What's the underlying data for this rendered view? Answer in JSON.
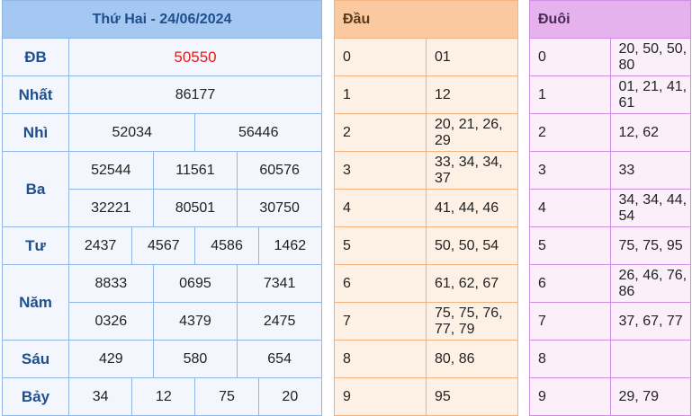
{
  "results": {
    "title": "Thứ Hai - 24/06/2024",
    "db": {
      "label": "ĐB",
      "values": [
        "50550"
      ]
    },
    "nhat": {
      "label": "Nhất",
      "values": [
        "86177"
      ]
    },
    "nhi": {
      "label": "Nhì",
      "values": [
        "52034",
        "56446"
      ]
    },
    "ba": {
      "label": "Ba",
      "values": [
        "52544",
        "11561",
        "60576",
        "32221",
        "80501",
        "30750"
      ]
    },
    "tu": {
      "label": "Tư",
      "values": [
        "2437",
        "4567",
        "4586",
        "1462"
      ]
    },
    "nam": {
      "label": "Năm",
      "values": [
        "8833",
        "0695",
        "7341",
        "0326",
        "4379",
        "2475"
      ]
    },
    "sau": {
      "label": "Sáu",
      "values": [
        "429",
        "580",
        "654"
      ]
    },
    "bay": {
      "label": "Bảy",
      "values": [
        "34",
        "12",
        "75",
        "20"
      ]
    }
  },
  "dau": {
    "header": "Đầu",
    "rows": [
      {
        "k": "0",
        "v": "01"
      },
      {
        "k": "1",
        "v": "12"
      },
      {
        "k": "2",
        "v": "20, 21, 26, 29"
      },
      {
        "k": "3",
        "v": "33, 34, 34, 37"
      },
      {
        "k": "4",
        "v": "41, 44, 46"
      },
      {
        "k": "5",
        "v": "50, 50, 54"
      },
      {
        "k": "6",
        "v": "61, 62, 67"
      },
      {
        "k": "7",
        "v": "75, 75, 76, 77, 79"
      },
      {
        "k": "8",
        "v": "80, 86"
      },
      {
        "k": "9",
        "v": "95"
      }
    ]
  },
  "duoi": {
    "header": "Đuôi",
    "rows": [
      {
        "k": "0",
        "v": "20, 50, 50, 80"
      },
      {
        "k": "1",
        "v": "01, 21, 41, 61"
      },
      {
        "k": "2",
        "v": "12, 62"
      },
      {
        "k": "3",
        "v": "33"
      },
      {
        "k": "4",
        "v": "34, 34, 44, 54"
      },
      {
        "k": "5",
        "v": "75, 75, 95"
      },
      {
        "k": "6",
        "v": "26, 46, 76, 86"
      },
      {
        "k": "7",
        "v": "37, 67, 77"
      },
      {
        "k": "8",
        "v": ""
      },
      {
        "k": "9",
        "v": "29, 79"
      }
    ]
  }
}
